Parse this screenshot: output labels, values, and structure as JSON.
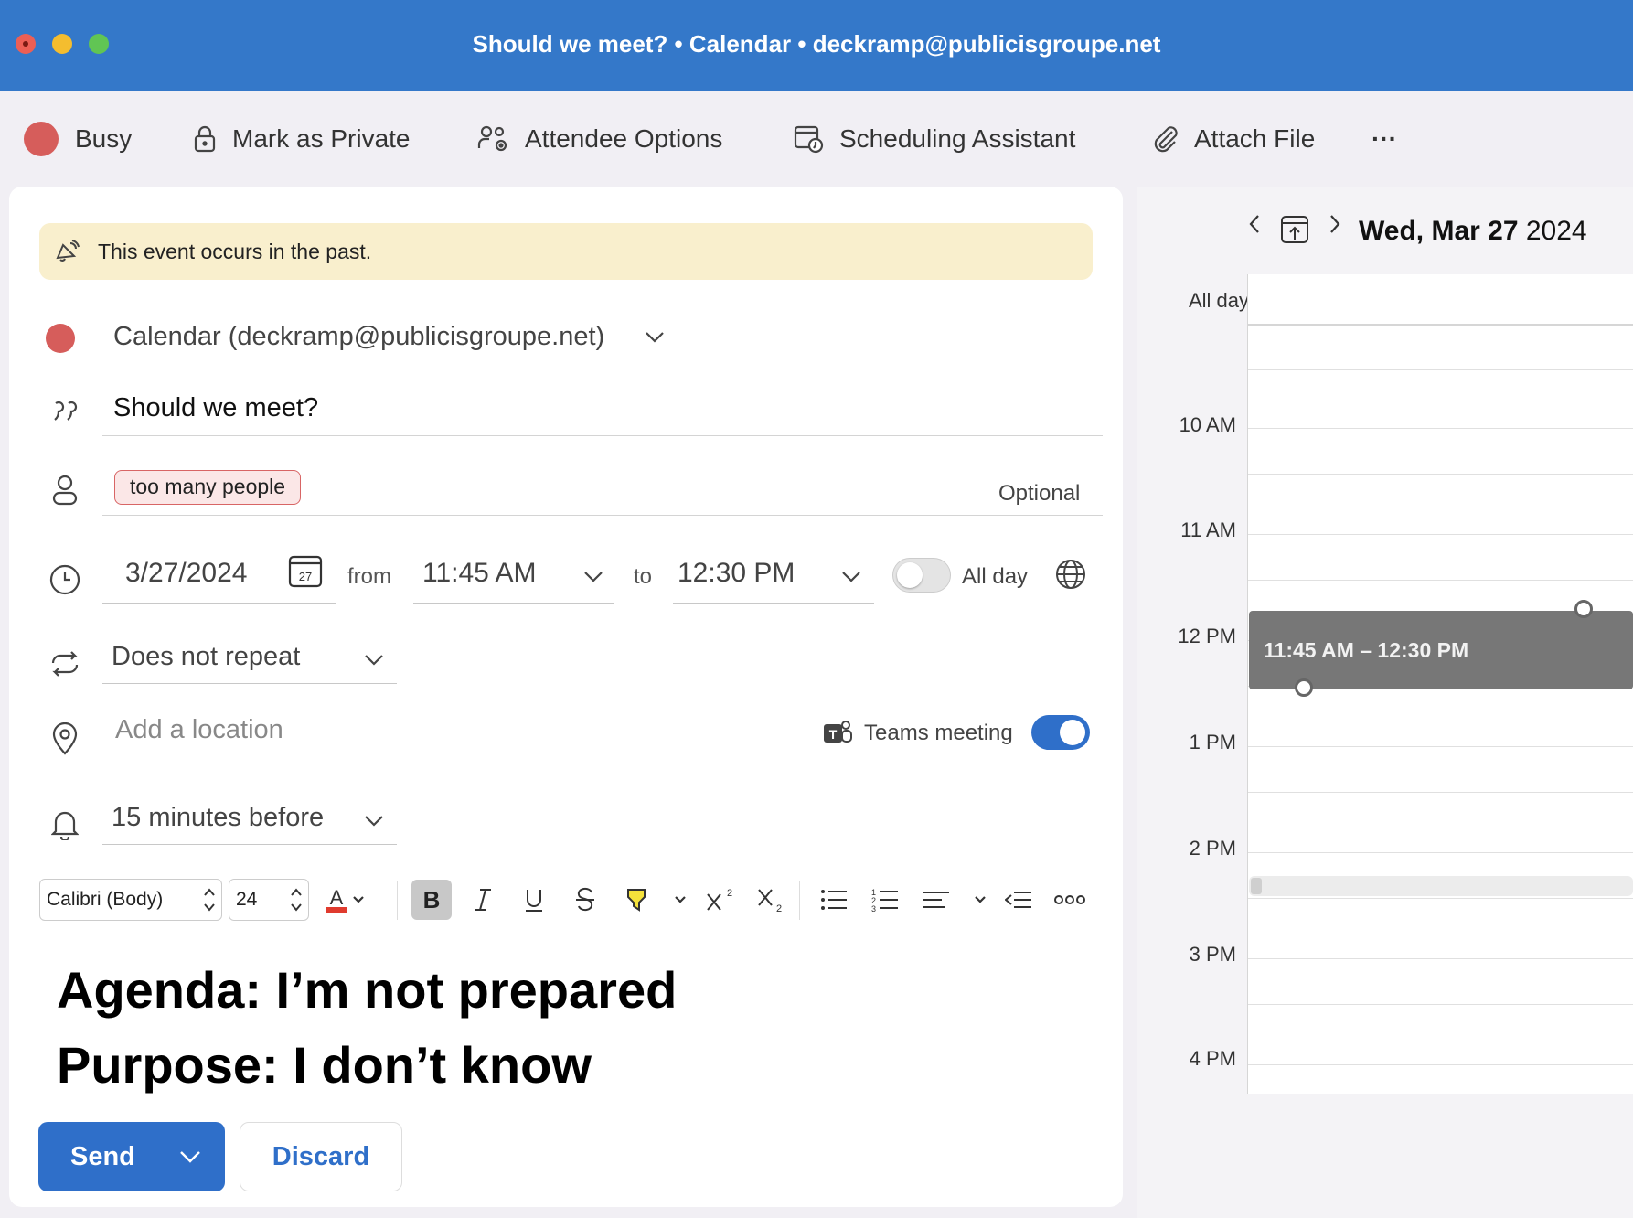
{
  "window": {
    "title": "Should we meet? • Calendar • deckramp@publicisgroupe.net"
  },
  "toolbar": {
    "busy_label": "Busy",
    "private_label": "Mark as Private",
    "attendee_label": "Attendee Options",
    "scheduling_label": "Scheduling Assistant",
    "attach_label": "Attach File",
    "more_label": "···"
  },
  "form": {
    "banner": "This event occurs in the past.",
    "calendar": "Calendar (deckramp@publicisgroupe.net)",
    "subject": "Should we meet?",
    "attendee": "too many people",
    "optional_label": "Optional",
    "date": "3/27/2024",
    "calendar_icon_day": "27",
    "from_label": "from",
    "start_time": "11:45 AM",
    "to_label": "to",
    "end_time": "12:30 PM",
    "allday_label": "All day",
    "allday_on": false,
    "repeat": "Does not repeat",
    "location_placeholder": "Add a location",
    "teams_label": "Teams meeting",
    "teams_on": true,
    "reminder": "15 minutes before"
  },
  "format": {
    "font": "Calibri (Body)",
    "size": "24"
  },
  "body": {
    "line1": "Agenda: I’m not prepared",
    "line2": "Purpose: I don’t know"
  },
  "actions": {
    "send": "Send",
    "discard": "Discard"
  },
  "day_view": {
    "date_weekday": "Wed, Mar 27",
    "date_year": "2024",
    "allday_label": "All day",
    "hours": [
      "10 AM",
      "11 AM",
      "12 PM",
      "1 PM",
      "2 PM",
      "3 PM",
      "4 PM"
    ],
    "event_time": "11:45 AM – 12:30 PM"
  },
  "colors": {
    "titlebar": "#3478c9",
    "accent": "#2f6fc9",
    "busy": "#d65d5b",
    "banner": "#f9efcd",
    "event": "#777777"
  }
}
